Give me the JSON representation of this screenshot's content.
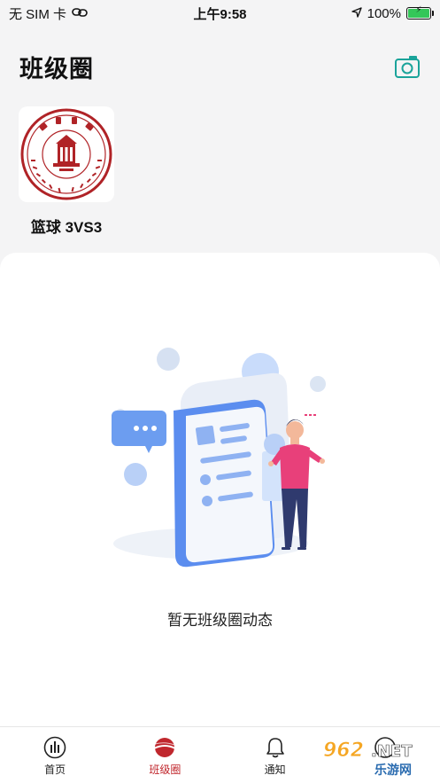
{
  "status_bar": {
    "carrier": "无 SIM 卡",
    "time": "上午9:58",
    "battery": "100%",
    "icons": [
      "link-icon",
      "location-arrow-icon",
      "battery-charging-icon"
    ]
  },
  "header": {
    "title": "班级圈",
    "camera_icon": "camera-icon"
  },
  "class_card": {
    "name": "篮球 3VS3",
    "logo_icon": "sichuan-university-seal"
  },
  "empty_state": {
    "message": "暂无班级圈动态"
  },
  "tabs": [
    {
      "label": "首页",
      "icon": "home-icon",
      "active": false
    },
    {
      "label": "班级圈",
      "icon": "class-circle-icon",
      "active": true
    },
    {
      "label": "通知",
      "icon": "bell-icon",
      "active": false
    }
  ],
  "watermark": {
    "top": "962.NET",
    "bottom": "乐游网"
  },
  "colors": {
    "accent_red": "#c0272d",
    "camera_teal": "#1aa39a",
    "illustration_blue": "#5b8def",
    "person_pink": "#e8407a"
  }
}
